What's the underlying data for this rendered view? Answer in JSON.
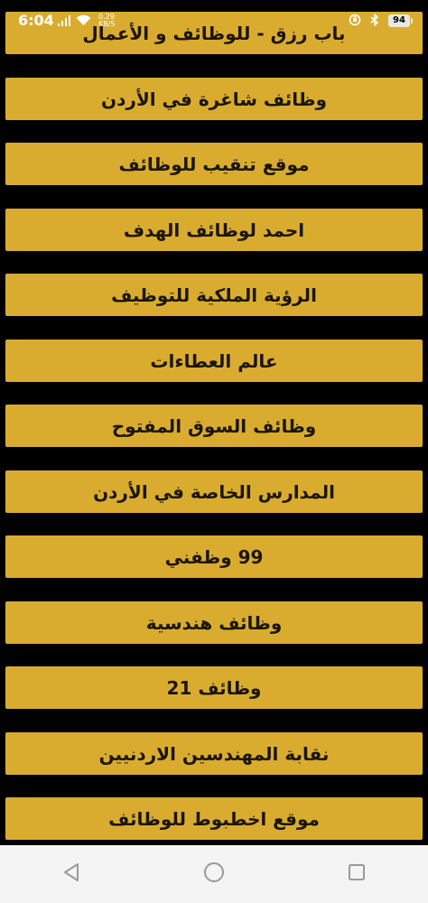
{
  "status_bar": {
    "time": "6:04",
    "net_speed_value": "0.29",
    "net_speed_unit": "KB/S",
    "battery": "94",
    "icons": [
      "signal-icon",
      "wifi-icon",
      "alarm-icon",
      "bluetooth-icon",
      "battery-icon"
    ]
  },
  "jobs": {
    "items": [
      {
        "label": "باب رزق - للوظائف و الأعمال"
      },
      {
        "label": "وظائف شاغرة في الأردن"
      },
      {
        "label": "موقع تنقيب للوظائف"
      },
      {
        "label": "احمد لوظائف الهدف"
      },
      {
        "label": "الرؤية الملكية للتوظيف"
      },
      {
        "label": "عالم العطاءات"
      },
      {
        "label": "وظائف السوق المفتوح"
      },
      {
        "label": "المدارس الخاصة في الأردن"
      },
      {
        "label": "99 وظفني"
      },
      {
        "label": "وظائف هندسية"
      },
      {
        "label": "وظائف 21"
      },
      {
        "label": "نقابة المهندسين الاردنيين"
      },
      {
        "label": "موقع اخطبوط للوظائف"
      }
    ]
  },
  "nav_bar": {
    "icons": [
      "back-icon",
      "home-icon",
      "recents-icon"
    ]
  },
  "colors": {
    "button_gold": "#d9ac30",
    "background": "#000000",
    "button_text": "#1c1608",
    "nav_bar": "#f4f4f4"
  }
}
